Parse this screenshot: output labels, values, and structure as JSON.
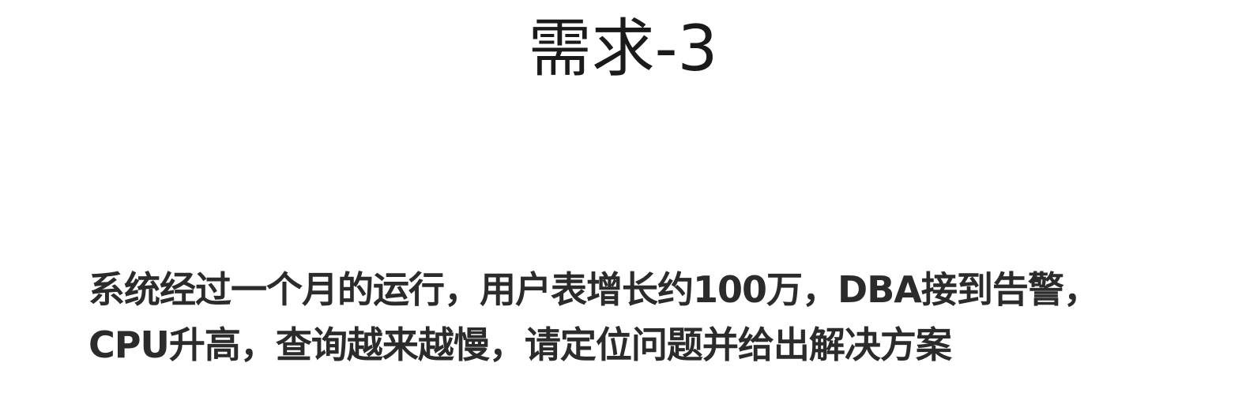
{
  "slide": {
    "title": "需求-3",
    "body_lines": [
      "系统经过一个月的运行，用户表增长约100万，DBA接到告警，",
      "CPU升高，查询越来越慢，请定位问题并给出解决方案"
    ]
  }
}
